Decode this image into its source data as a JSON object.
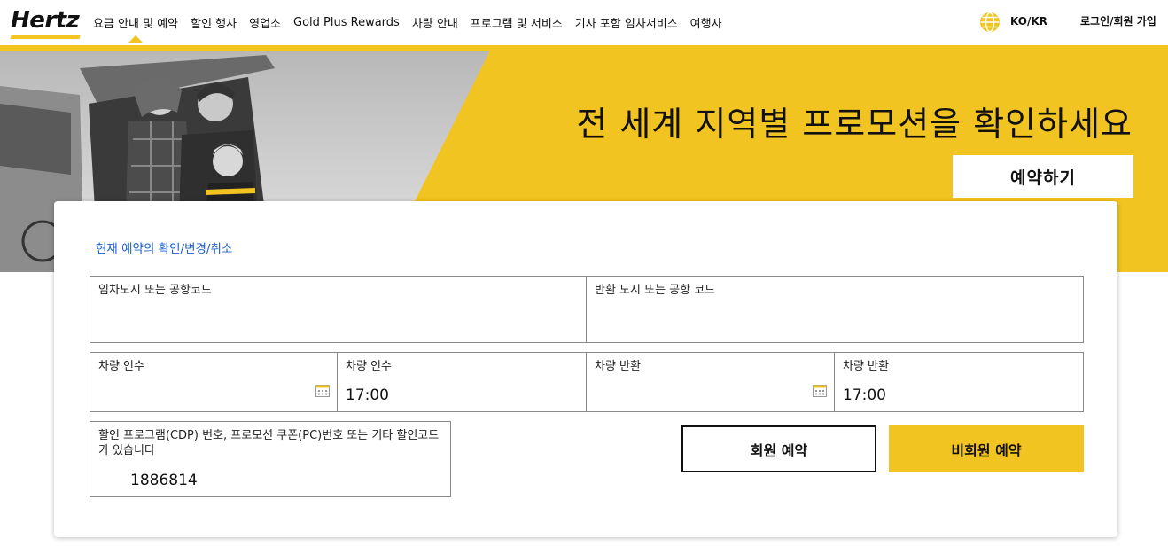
{
  "header": {
    "logo": "Hertz",
    "nav": [
      {
        "label": "요금 안내 및 예약",
        "active": true
      },
      {
        "label": "할인 행사"
      },
      {
        "label": "영업소"
      },
      {
        "label": "Gold Plus Rewards"
      },
      {
        "label": "차량 안내"
      },
      {
        "label": "프로그램 및 서비스"
      },
      {
        "label": "기사 포함 임차서비스"
      },
      {
        "label": "여행사"
      }
    ],
    "language": "KO/KR",
    "login": "로그인/회원 가입"
  },
  "hero": {
    "title": "전 세계 지역별 프로모션을 확인하세요",
    "book_button": "예약하기"
  },
  "form": {
    "manage_link": "현재 예약의 확인/변경/취소",
    "pickup_location": {
      "label": "임차도시 또는 공항코드",
      "value": ""
    },
    "return_location": {
      "label": "반환 도시 또는 공항 코드",
      "value": ""
    },
    "pickup_date": {
      "label": "차량 인수",
      "value": ""
    },
    "pickup_time": {
      "label": "차량 인수",
      "value": "17:00"
    },
    "return_date": {
      "label": "차량 반환",
      "value": ""
    },
    "return_time": {
      "label": "차량 반환",
      "value": "17:00"
    },
    "discount": {
      "label": "할인 프로그램(CDP) 번호, 프로모션 쿠폰(PC)번호 또는 기타 할인코드가 있습니다",
      "value": "1886814"
    },
    "member_button": "회원 예약",
    "guest_button": "비회원 예약"
  },
  "colors": {
    "brand_yellow": "#f2c421",
    "link_blue": "#1a5fd0"
  }
}
